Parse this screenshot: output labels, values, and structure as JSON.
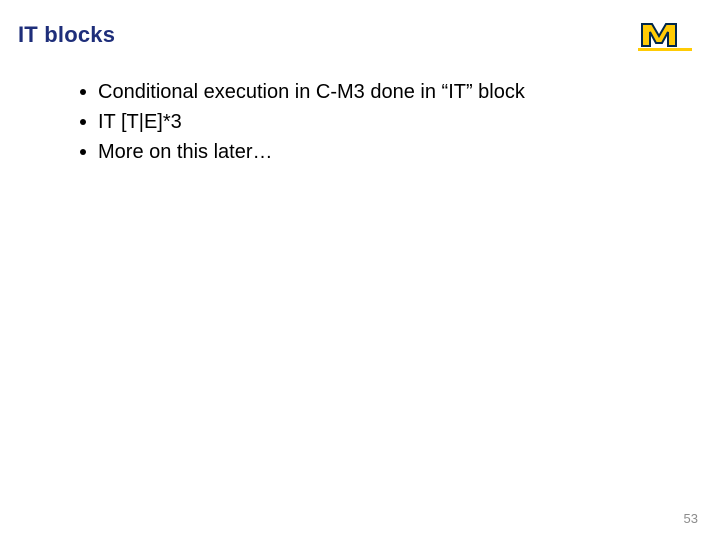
{
  "title": "IT blocks",
  "bullets": [
    "Conditional execution in C-M3 done in “IT” block",
    "IT [T|E]*3",
    "More on this later…"
  ],
  "page_number": "53",
  "brand": {
    "maize": "#ffcb05",
    "blue": "#00274c"
  }
}
